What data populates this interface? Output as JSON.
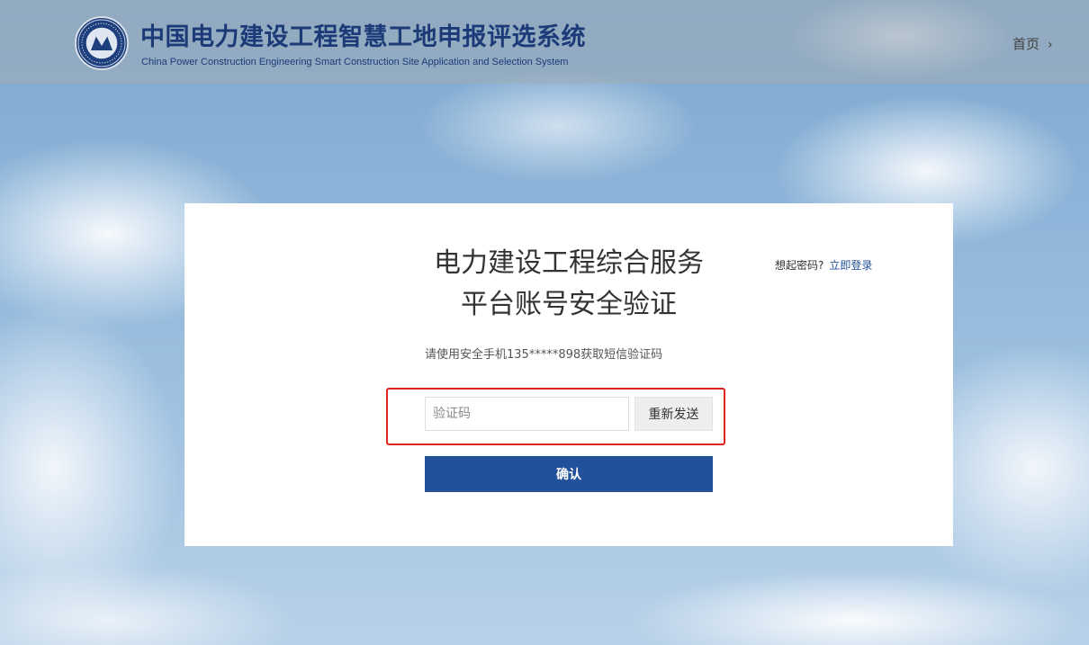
{
  "header": {
    "title_cn": "中国电力建设工程智慧工地申报评选系统",
    "title_en": "China Power Construction Engineering Smart Construction Site Application and Selection System",
    "logo_icon": "association-emblem-icon",
    "home_label": "首页",
    "home_icon": "chevron-right-icon"
  },
  "card": {
    "title_line1": "电力建设工程综合服务",
    "title_line2": "平台账号安全验证",
    "remember_question": "想起密码?",
    "login_link": "立即登录",
    "hint": "请使用安全手机135*****898获取短信验证码",
    "code_input": {
      "value": "",
      "placeholder": "验证码"
    },
    "resend_label": "重新发送",
    "confirm_label": "确认"
  },
  "colors": {
    "brand_blue": "#22509a",
    "title_blue": "#1c3a78",
    "link_blue": "#1f4e97",
    "highlight_red": "#e0241e"
  }
}
